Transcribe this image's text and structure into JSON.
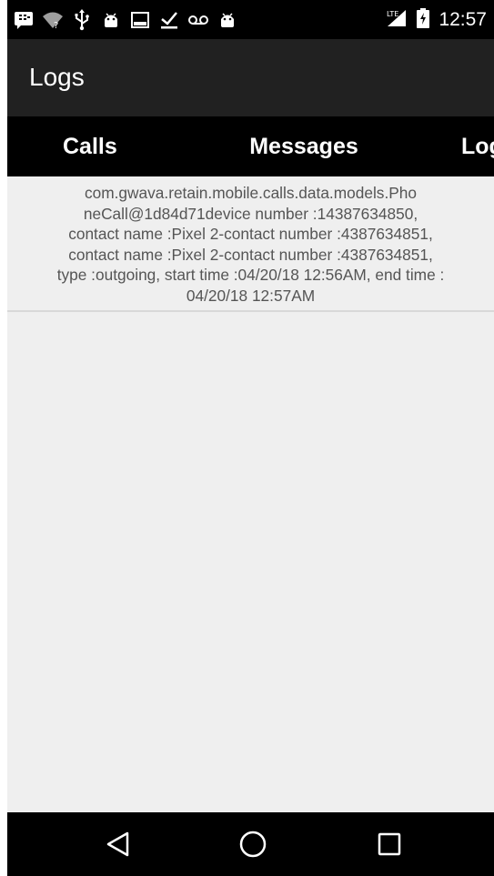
{
  "status_bar": {
    "icons": [
      "bbm-icon",
      "wifi-icon",
      "usb-icon",
      "android-icon",
      "image-icon",
      "download-done-icon",
      "voicemail-icon",
      "android-icon",
      "signal-icon",
      "battery-icon"
    ],
    "time": "12:57"
  },
  "app_bar": {
    "title": "Logs"
  },
  "tabs": [
    {
      "label": "Calls"
    },
    {
      "label": "Messages"
    },
    {
      "label": "Logs"
    }
  ],
  "logs": [
    {
      "text": "com.gwava.retain.mobile.calls.data.models.Pho\nneCall@1d84d71device number :14387634850,\ncontact name :Pixel 2-contact number :4387634851,\ncontact name :Pixel 2-contact number :4387634851,\ntype :outgoing, start time :04/20/18 12:56AM, end time :\n04/20/18 12:57AM"
    }
  ],
  "nav_bar": {
    "buttons": [
      "back-icon",
      "home-icon",
      "recents-icon"
    ]
  },
  "colors": {
    "status_bar": "#000000",
    "app_bar": "#212121",
    "tab_bar": "#000000",
    "content_bg": "#efefef",
    "log_text": "#555555"
  }
}
